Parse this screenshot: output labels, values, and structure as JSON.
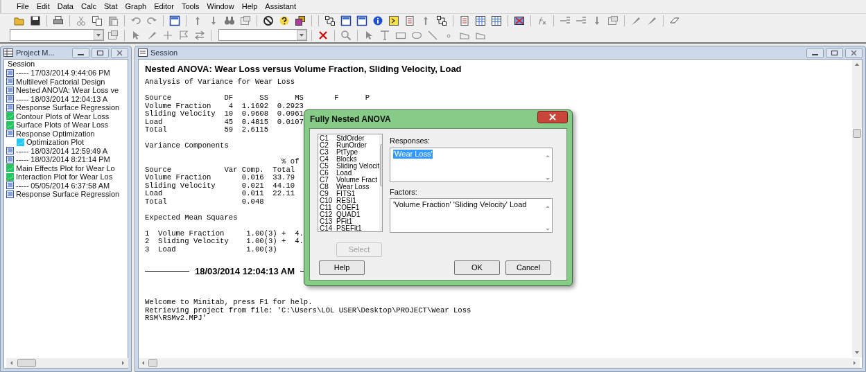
{
  "menu": [
    {
      "label": "File"
    },
    {
      "label": "Edit"
    },
    {
      "label": "Data"
    },
    {
      "label": "Calc"
    },
    {
      "label": "Stat"
    },
    {
      "label": "Graph"
    },
    {
      "label": "Editor"
    },
    {
      "label": "Tools"
    },
    {
      "label": "Window"
    },
    {
      "label": "Help"
    },
    {
      "label": "Assistant"
    }
  ],
  "project_manager": {
    "title": "Project M...",
    "header": "Session",
    "items": [
      {
        "kind": "output",
        "label": "----- 17/03/2014 9:44:06 PM"
      },
      {
        "kind": "output",
        "label": "Multilevel Factorial Design"
      },
      {
        "kind": "output",
        "label": "Nested ANOVA: Wear Loss ve"
      },
      {
        "kind": "output",
        "label": "----- 18/03/2014 12:04:13 A"
      },
      {
        "kind": "output",
        "label": "Response Surface Regression"
      },
      {
        "kind": "graph",
        "color": "#22c55e",
        "label": "Contour Plots of Wear Loss"
      },
      {
        "kind": "graph",
        "color": "#22c55e",
        "label": "Surface Plots of Wear Loss"
      },
      {
        "kind": "output",
        "label": "Response Optimization",
        "children": [
          {
            "kind": "graph",
            "color": "#22c8f0",
            "label": "Optimization Plot"
          }
        ]
      },
      {
        "kind": "output",
        "label": "----- 18/03/2014 12:59:49 A"
      },
      {
        "kind": "output",
        "label": "----- 18/03/2014 8:21:14 PM"
      },
      {
        "kind": "graph",
        "color": "#22c55e",
        "label": "Main Effects Plot for Wear Lo"
      },
      {
        "kind": "graph",
        "color": "#22c55e",
        "label": "Interaction Plot for Wear Los"
      },
      {
        "kind": "output",
        "label": "----- 05/05/2014 6:37:58 AM"
      },
      {
        "kind": "output",
        "label": "Response Surface Regression"
      }
    ]
  },
  "session": {
    "title": "Session",
    "blocks": [
      {
        "kind": "heading",
        "text": "Nested ANOVA: Wear Loss versus Volume Fraction, Sliding Velocity, Load"
      },
      {
        "kind": "output",
        "lines": [
          "Analysis of Variance for Wear Loss"
        ]
      },
      {
        "kind": "output",
        "lines": [
          "Source            DF      SS      MS       F      P",
          "Volume Fraction    4  1.1692  0.2923",
          "Sliding Velocity  10  0.9608  0.0961",
          "Load              45  0.4815  0.0107",
          "Total             59  2.6115"
        ]
      },
      {
        "kind": "output",
        "lines": [
          "Variance Components"
        ]
      },
      {
        "kind": "output",
        "lines": [
          "                               % of",
          "Source            Var Comp.  Total",
          "Volume Fraction       0.016  33.79",
          "Sliding Velocity      0.021  44.10",
          "Load                  0.011  22.11",
          "Total                 0.048"
        ]
      },
      {
        "kind": "output",
        "lines": [
          "Expected Mean Squares"
        ]
      },
      {
        "kind": "output",
        "lines": [
          "1  Volume Fraction     1.00(3) +  4.",
          "2  Sliding Velocity    1.00(3) +  4.",
          "3  Load                1.00(3)"
        ]
      },
      {
        "kind": "timestamp",
        "text": "18/03/2014 12:04:13 AM"
      },
      {
        "kind": "output",
        "lines": [
          "Welcome to Minitab, press F1 for help.",
          "Retrieving project from file: 'C:\\Users\\LOL USER\\Desktop\\PROJECT\\Wear Loss",
          "RSM\\RSMv2.MPJ'"
        ]
      }
    ]
  },
  "dialog": {
    "title": "Fully Nested ANOVA",
    "columns": [
      {
        "id": "C1",
        "name": "StdOrder"
      },
      {
        "id": "C2",
        "name": "RunOrder"
      },
      {
        "id": "C3",
        "name": "PtType"
      },
      {
        "id": "C4",
        "name": "Blocks"
      },
      {
        "id": "C5",
        "name": "Sliding Velocit"
      },
      {
        "id": "C6",
        "name": "Load"
      },
      {
        "id": "C7",
        "name": "Volume Fract"
      },
      {
        "id": "C8",
        "name": "Wear Loss"
      },
      {
        "id": "C9",
        "name": "FITS1"
      },
      {
        "id": "C10",
        "name": "RESI1"
      },
      {
        "id": "C11",
        "name": "COEF1"
      },
      {
        "id": "C12",
        "name": "QUAD1"
      },
      {
        "id": "C13",
        "name": "PFit1"
      },
      {
        "id": "C14",
        "name": "PSEFit1"
      }
    ],
    "responses": {
      "label": "Responses:",
      "value": "'Wear Loss'",
      "selected": true
    },
    "factors": {
      "label": "Factors:",
      "value": "'Volume Fraction' 'Sliding Velocity' Load",
      "selected": false
    },
    "buttons": [
      {
        "kind": "select",
        "label": "Select",
        "disabled": true
      },
      {
        "kind": "help",
        "label": "Help",
        "disabled": false
      },
      {
        "kind": "ok",
        "label": "OK",
        "disabled": false
      },
      {
        "kind": "cancel",
        "label": "Cancel",
        "disabled": false
      }
    ]
  }
}
